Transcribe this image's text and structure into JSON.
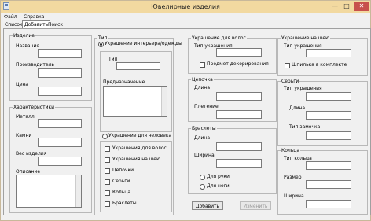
{
  "window": {
    "title": "Ювелирные изделия",
    "min_glyph": "—",
    "max_glyph": "□",
    "close_glyph": "✕"
  },
  "menu": [
    "Файл",
    "Справка"
  ],
  "tabs": [
    "Список",
    "Добавить",
    "Поиск"
  ],
  "groups": {
    "item": {
      "title": "Изделие",
      "name_label": "Название",
      "maker_label": "Производитель",
      "price_label": "Цена"
    },
    "chars": {
      "title": "Характеристики",
      "metal_label": "Металл",
      "stones_label": "Камни",
      "weight_label": "Вес изделия",
      "desc_label": "Описание"
    },
    "type": {
      "title": "Тип",
      "interior_radio": "Украшение интерьера/одежды",
      "type_label": "Тип",
      "purpose_label": "Предназначение",
      "person_radio": "Украшение для человека",
      "hair_chk": "Украшения для волос",
      "neck_chk": "Украшения на шею",
      "chain_chk": "Цепочки",
      "earrings_chk": "Серьги",
      "rings_chk": "Кольца",
      "bracelets_chk": "Браслеты"
    },
    "hair": {
      "title": "Украшение для волос",
      "type_label": "Тип украшения",
      "decor_chk": "Предмет декорирования"
    },
    "chain": {
      "title": "Цепочка",
      "length_label": "Длина",
      "weave_label": "Плетение"
    },
    "bracelets": {
      "title": "Браслеты",
      "length_label": "Длина",
      "width_label": "Ширина",
      "hand_radio": "Для руки",
      "leg_radio": "Для ноги"
    },
    "neck": {
      "title": "Украшение на шею",
      "type_label": "Тип украшения",
      "pendant_chk": "Шпилька в комплекте"
    },
    "earrings": {
      "title": "Серьги",
      "type_label": "Тип украшения",
      "length_label": "Длина",
      "clasp_label": "Тип замочка"
    },
    "rings": {
      "title": "Кольца",
      "type_label": "Тип кольца",
      "size_label": "Размер",
      "width_label": "Ширина"
    }
  },
  "buttons": {
    "add": "Добавить",
    "edit": "Изменить"
  }
}
